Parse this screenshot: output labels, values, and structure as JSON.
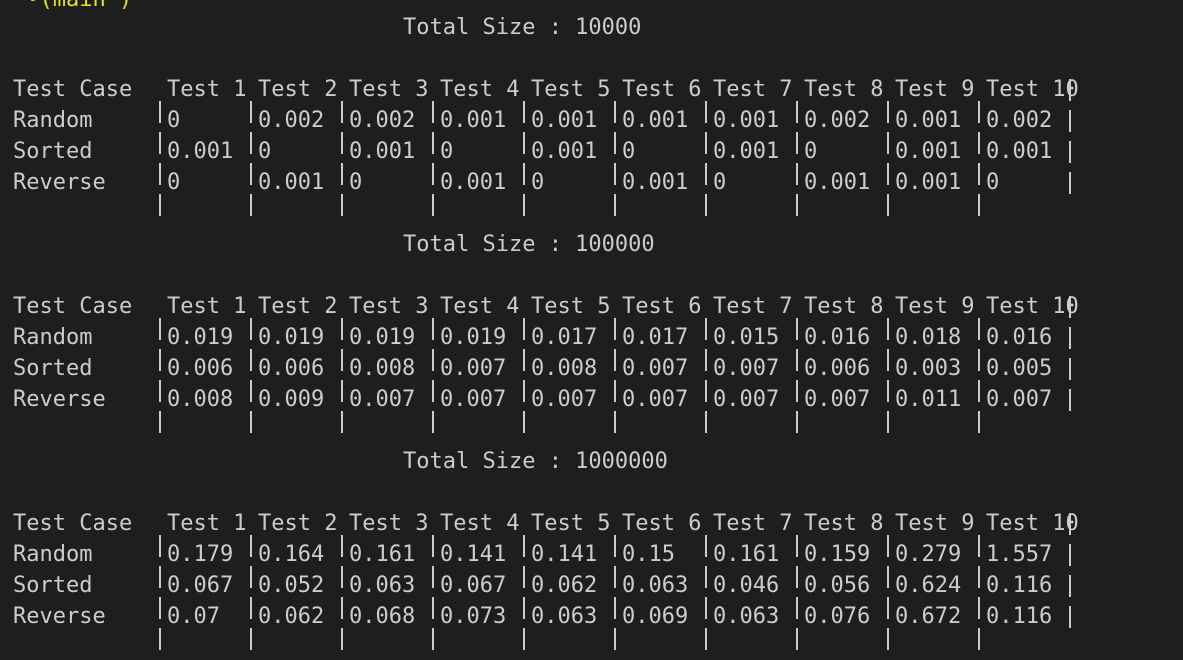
{
  "prompt_fragment": " •(main )",
  "tables": [
    {
      "title": "Total Size : 10000",
      "header": [
        "Test Case",
        "Test 1",
        "Test 2",
        "Test 3",
        "Test 4",
        "Test 5",
        "Test 6",
        "Test 7",
        "Test 8",
        "Test 9",
        "Test 10"
      ],
      "rows": [
        {
          "label": "Random",
          "values": [
            "0",
            "0.002",
            "0.002",
            "0.001",
            "0.001",
            "0.001",
            "0.001",
            "0.002",
            "0.001",
            "0.002"
          ]
        },
        {
          "label": "Sorted",
          "values": [
            "0.001",
            "0",
            "0.001",
            "0",
            "0.001",
            "0",
            "0.001",
            "0",
            "0.001",
            "0.001"
          ]
        },
        {
          "label": "Reverse",
          "values": [
            "0",
            "0.001",
            "0",
            "0.001",
            "0",
            "0.001",
            "0",
            "0.001",
            "0.001",
            "0"
          ]
        }
      ]
    },
    {
      "title": "Total Size : 100000",
      "header": [
        "Test Case",
        "Test 1",
        "Test 2",
        "Test 3",
        "Test 4",
        "Test 5",
        "Test 6",
        "Test 7",
        "Test 8",
        "Test 9",
        "Test 10"
      ],
      "rows": [
        {
          "label": "Random",
          "values": [
            "0.019",
            "0.019",
            "0.019",
            "0.019",
            "0.017",
            "0.017",
            "0.015",
            "0.016",
            "0.018",
            "0.016"
          ]
        },
        {
          "label": "Sorted",
          "values": [
            "0.006",
            "0.006",
            "0.008",
            "0.007",
            "0.008",
            "0.007",
            "0.007",
            "0.006",
            "0.003",
            "0.005"
          ]
        },
        {
          "label": "Reverse",
          "values": [
            "0.008",
            "0.009",
            "0.007",
            "0.007",
            "0.007",
            "0.007",
            "0.007",
            "0.007",
            "0.011",
            "0.007"
          ]
        }
      ]
    },
    {
      "title": "Total Size : 1000000",
      "header": [
        "Test Case",
        "Test 1",
        "Test 2",
        "Test 3",
        "Test 4",
        "Test 5",
        "Test 6",
        "Test 7",
        "Test 8",
        "Test 9",
        "Test 10"
      ],
      "rows": [
        {
          "label": "Random",
          "values": [
            "0.179",
            "0.164",
            "0.161",
            "0.141",
            "0.141",
            "0.15",
            "0.161",
            "0.159",
            "0.279",
            "1.557"
          ]
        },
        {
          "label": "Sorted",
          "values": [
            "0.067",
            "0.052",
            "0.063",
            "0.067",
            "0.062",
            "0.063",
            "0.046",
            "0.056",
            "0.624",
            "0.116"
          ]
        },
        {
          "label": "Reverse",
          "values": [
            "0.07",
            "0.062",
            "0.068",
            "0.073",
            "0.063",
            "0.069",
            "0.063",
            "0.076",
            "0.672",
            "0.116"
          ]
        }
      ]
    }
  ],
  "colors": {
    "background": "#1e1e1e",
    "text": "#cccccc",
    "prompt": "#e5e510"
  }
}
